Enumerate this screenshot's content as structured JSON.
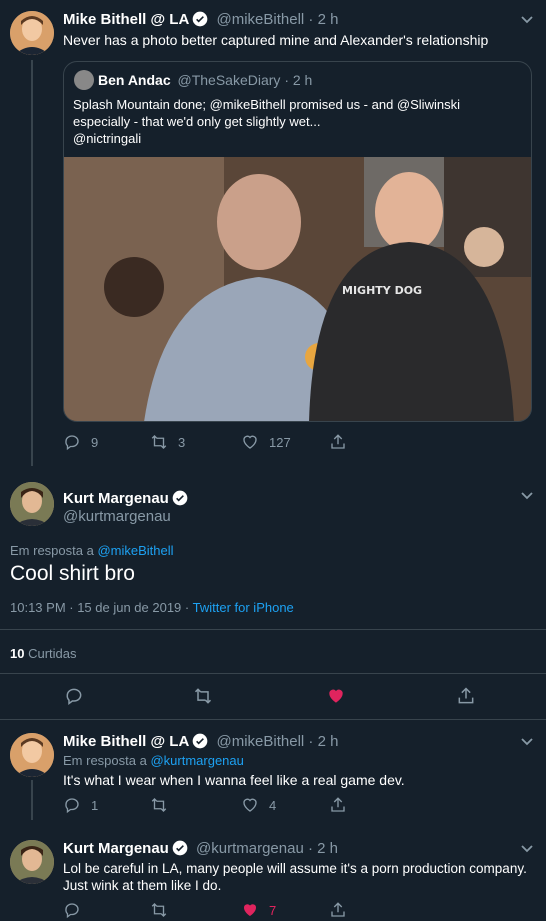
{
  "tweet1": {
    "author_name": "Mike Bithell @ LA",
    "handle": "@mikeBithell",
    "time": "· 2 h",
    "text": "Never has a photo better captured mine and Alexander's relationship",
    "quote": {
      "author_name": "Ben Andac",
      "handle": "@TheSakeDiary",
      "time": "· 2 h",
      "text": "Splash Mountain done; @mikeBithell promised us - and @Sliwinski especially - that we'd only get slightly wet...",
      "text_line2": "@nictringali",
      "shirt_text": "MIGHTY DOG"
    },
    "replies": "9",
    "retweets": "3",
    "likes": "127"
  },
  "main": {
    "author_name": "Kurt Margenau",
    "handle": "@kurtmargenau",
    "reply_prefix": "Em resposta a",
    "reply_to": "@mikeBithell",
    "text": "Cool shirt bro",
    "timestamp": "10:13 PM · 15 de jun de 2019 ·",
    "source": "Twitter for iPhone",
    "likes_count": "10",
    "likes_label": "Curtidas"
  },
  "reply1": {
    "author_name": "Mike Bithell @ LA",
    "handle": "@mikeBithell",
    "time": "· 2 h",
    "reply_prefix": "Em resposta a",
    "reply_to": "@kurtmargenau",
    "text": "It's what I wear when I wanna feel like a real game dev.",
    "replies": "1",
    "retweets": "",
    "likes": "4"
  },
  "reply2": {
    "author_name": "Kurt Margenau",
    "handle": "@kurtmargenau",
    "time": "· 2 h",
    "text_line1": "Lol be careful in LA, many people will assume it's a porn production company.",
    "text_line2": "Just wink at them like I do.",
    "likes": "7"
  },
  "colors": {
    "background": "#15202b",
    "accent": "#1da1f2",
    "muted": "#8899a6",
    "like": "#e0245e",
    "border": "#38444d"
  }
}
